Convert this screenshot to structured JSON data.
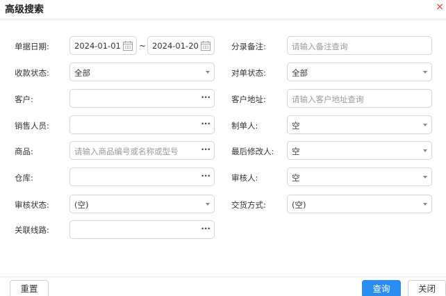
{
  "dialog": {
    "title": "高级搜索",
    "close_glyph": "×"
  },
  "form": {
    "doc_date": {
      "label": "单据日期:",
      "from": "2024-01-01",
      "to": "2024-01-20",
      "separator": "~"
    },
    "entry_note": {
      "label": "分录备注:",
      "placeholder": "请输入备注查询"
    },
    "receipt_status": {
      "label": "收款状态:",
      "value": "全部"
    },
    "reconcile_status": {
      "label": "对单状态:",
      "value": "全部"
    },
    "customer": {
      "label": "客户:",
      "value": ""
    },
    "customer_address": {
      "label": "客户地址:",
      "placeholder": "请输入客户地址查询"
    },
    "salesperson": {
      "label": "销售人员:",
      "value": ""
    },
    "creator": {
      "label": "制单人:",
      "value": "空"
    },
    "product": {
      "label": "商品:",
      "placeholder": "请输入商品编号或名称或型号"
    },
    "last_modifier": {
      "label": "最后修改人:",
      "value": "空"
    },
    "warehouse": {
      "label": "仓库:",
      "value": ""
    },
    "reviewer": {
      "label": "审核人:",
      "value": "空"
    },
    "review_status": {
      "label": "审核状态:",
      "value": "(空)"
    },
    "delivery_method": {
      "label": "交货方式:",
      "value": "(空)"
    },
    "route": {
      "label": "关联线路:",
      "value": ""
    },
    "lookup_glyph": "···"
  },
  "buttons": {
    "reset": "重置",
    "query": "查询",
    "close": "关闭"
  },
  "colors": {
    "primary": "#2a8ef0",
    "close_icon": "#e53935"
  }
}
